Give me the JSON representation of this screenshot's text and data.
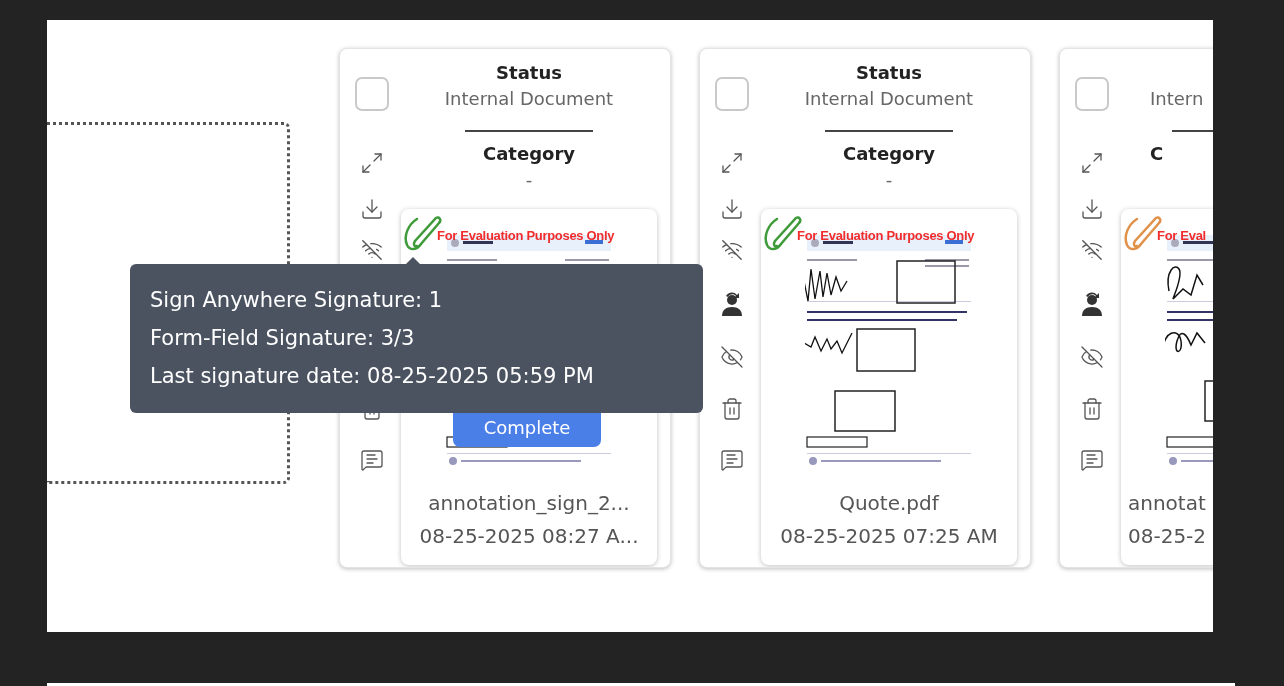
{
  "cards": [
    {
      "checked": false,
      "status_label": "Status",
      "status": "Internal Document",
      "category_label": "Category",
      "category": "-",
      "color": "#3f9a3a",
      "watermark": "For Evaluation Purposes Only",
      "complete_button": "Complete",
      "file_name": "annotation_sign_2...",
      "date": "08-25-2025 08:27 A..."
    },
    {
      "checked": false,
      "status_label": "Status",
      "status": "Internal Document",
      "category_label": "Category",
      "category": "-",
      "color": "#3f9a3a",
      "watermark": "For Evaluation Purposes Only",
      "file_name": "Quote.pdf",
      "date": "08-25-2025 07:25 AM"
    },
    {
      "checked": false,
      "status": "Intern",
      "category_label": "C",
      "color": "#e0914a",
      "watermark": "For Eval",
      "file_name": "annotat",
      "date": "08-25-2"
    }
  ],
  "tooltip": {
    "lines": [
      "Sign Anywhere Signature: 1",
      "Form-Field Signature: 3/3",
      "Last signature date: 08-25-2025 05:59 PM"
    ]
  }
}
